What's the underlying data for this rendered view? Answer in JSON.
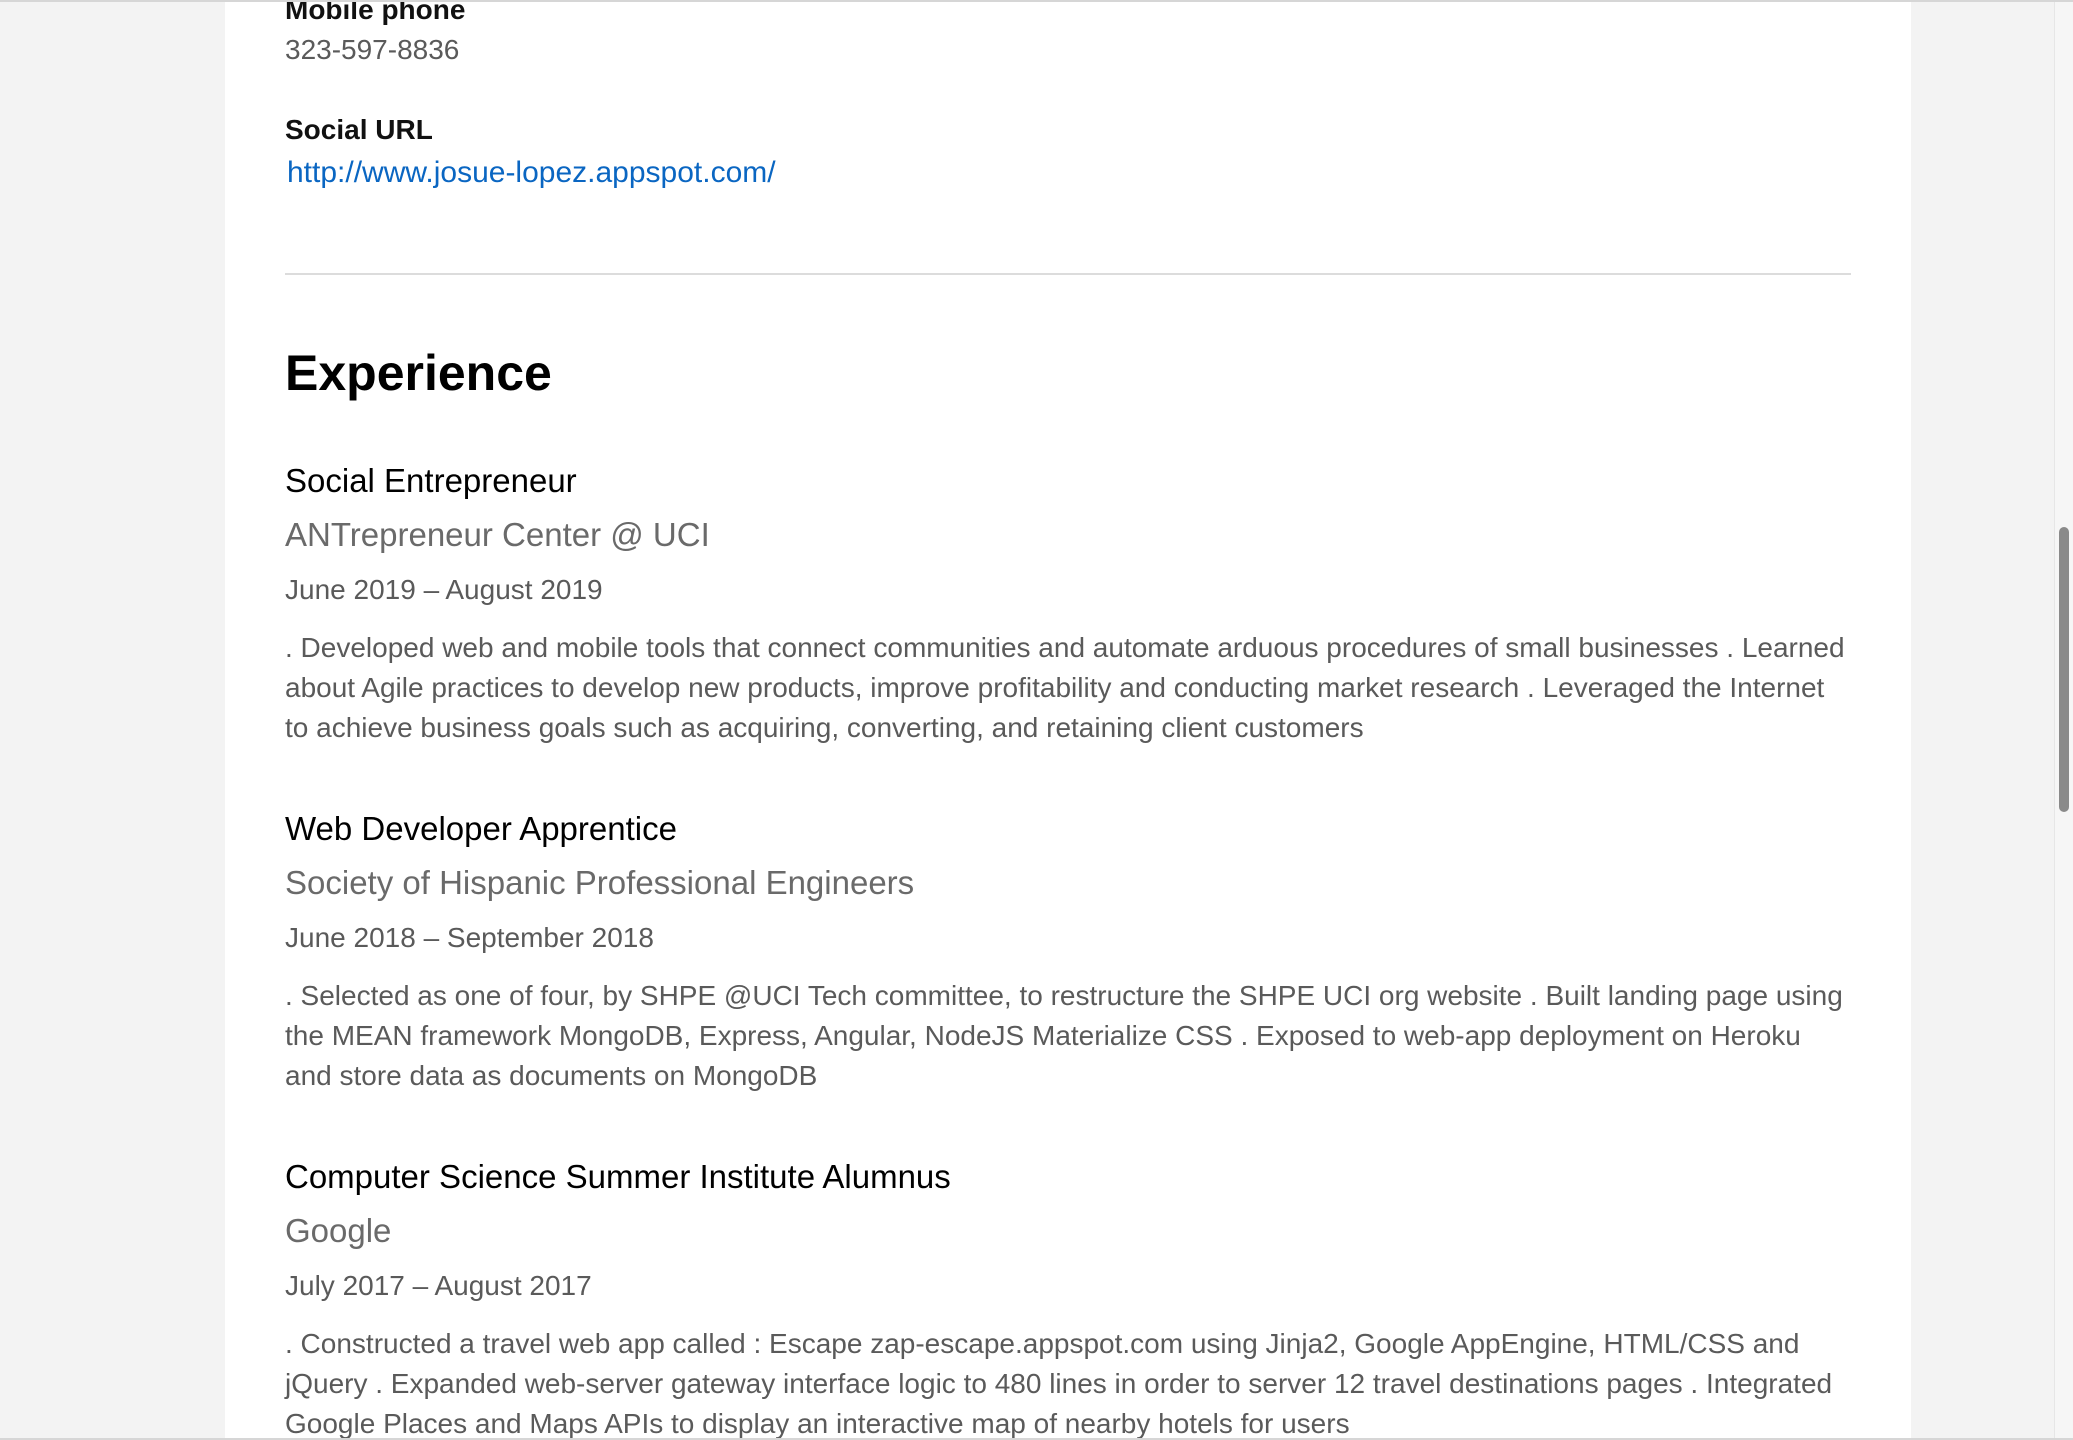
{
  "contact": {
    "mobile_label": "Mobile phone",
    "mobile_value": "323-597-8836",
    "social_label": "Social URL",
    "social_url": "http://www.josue-lopez.appspot.com/"
  },
  "experience": {
    "heading": "Experience",
    "entries": [
      {
        "title": "Social Entrepreneur",
        "company": "ANTrepreneur Center @ UCI",
        "dates": "June 2019 – August 2019",
        "description": ". Developed web and mobile tools that connect communities and automate arduous procedures of small businesses . Learned about Agile practices to develop new products, improve profitability and conducting market research . Leveraged the Internet to achieve business goals such as acquiring, converting, and retaining client customers"
      },
      {
        "title": "Web Developer Apprentice",
        "company": "Society of Hispanic Professional Engineers",
        "dates": "June 2018 – September 2018",
        "description": ". Selected as one of four, by SHPE @UCI Tech committee, to restructure the SHPE UCI org website . Built landing page using the MEAN framework MongoDB, Express, Angular, NodeJS Materialize CSS . Exposed to web-app deployment on Heroku and store data as documents on MongoDB"
      },
      {
        "title": "Computer Science Summer Institute Alumnus",
        "company": "Google",
        "dates": "July 2017 – August 2017",
        "description": ". Constructed a travel web app called : Escape zap-escape.appspot.com using Jinja2, Google AppEngine, HTML/CSS and jQuery . Expanded web-server gateway interface logic to 480 lines in order to server 12 travel destinations pages . Integrated Google Places and Maps APIs to display an interactive map of nearby hotels for users"
      }
    ]
  },
  "colors": {
    "link": "#0a66c2",
    "heading": "#000000",
    "muted_text": "#5a5a5a",
    "page_background": "#f3f3f3",
    "card_background": "#ffffff"
  }
}
